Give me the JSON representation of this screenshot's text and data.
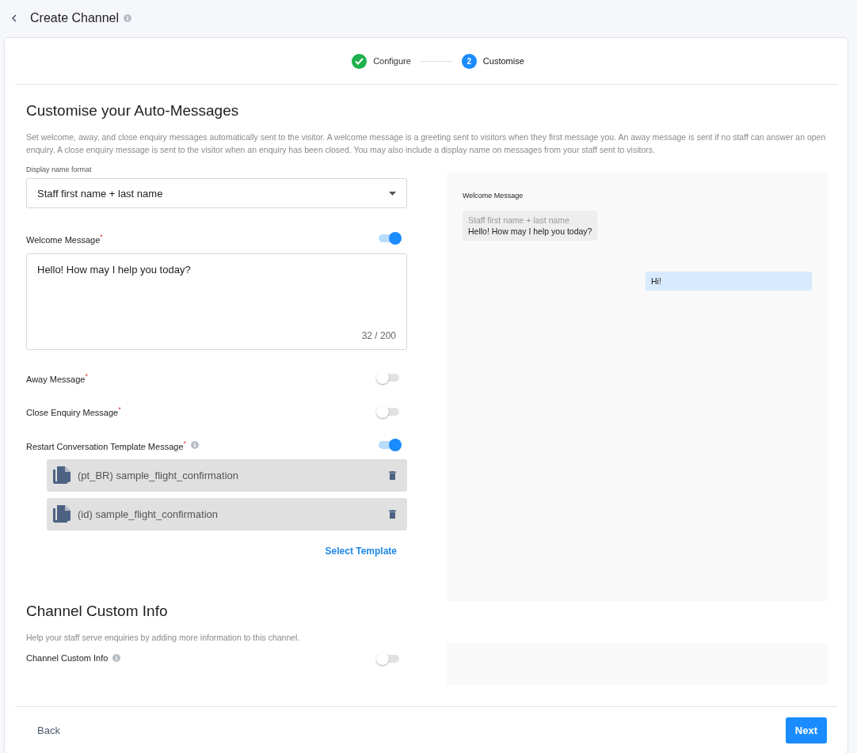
{
  "header": {
    "title": "Create Channel",
    "info": true
  },
  "steps": [
    {
      "label": "Configure",
      "done": true
    },
    {
      "label": "Customise",
      "number": "2",
      "done": false
    }
  ],
  "auto_messages": {
    "title": "Customise your Auto-Messages",
    "description": "Set welcome, away, and close enquiry messages automatically sent to the visitor. A welcome message is a greeting sent to visitors when they first message you. An away message is sent if no staff can answer an open enquiry. A close enquiry message is sent to the visitor when an enquiry has been closed. You may also include a display name on messages from your staff sent to visitors.",
    "display_name": {
      "label": "Display name format",
      "value": "Staff first name + last name"
    },
    "settings": [
      {
        "kind": "textarea",
        "label": "Welcome Message$^{*}$",
        "info": false,
        "on": true,
        "value": "Hello! How may I help you today?",
        "counter": "32 / 200"
      },
      {
        "kind": "plain",
        "label": "Away Message$^{*}$",
        "info": false,
        "on": false
      },
      {
        "kind": "plain",
        "label": "Close Enquiry Message$^{*}$",
        "info": false,
        "on": false
      },
      {
        "kind": "templates",
        "label": "Restart Conversation Template Message$^{*}$",
        "info": true,
        "on": true,
        "templates": [
          "(pt_BR) sample_flight_confirmation",
          "(id) sample_flight_confirmation"
        ],
        "action": "Select Template"
      }
    ],
    "preview": {
      "label": "Welcome Message",
      "bubbles": [
        {
          "kind": "staff",
          "name": "Staff first name + last name",
          "text": "Hello! How may I help you today?"
        },
        {
          "kind": "visitor",
          "text": "Hi!"
        }
      ]
    }
  },
  "custom_info": {
    "title": "Channel Custom Info",
    "description": "Help your staff serve enquiries by adding more information to this channel.",
    "label": "Channel Custom Info",
    "info": true,
    "on": false
  },
  "footer": {
    "back": "Back",
    "next": "Next"
  }
}
